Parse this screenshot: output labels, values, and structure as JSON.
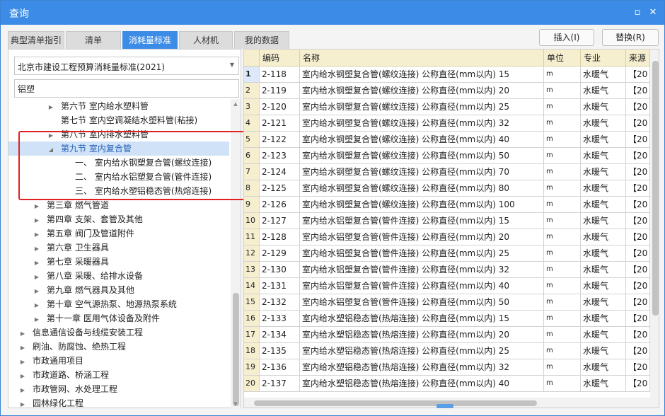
{
  "window": {
    "title": "查询",
    "min": "▫",
    "close": "✕"
  },
  "tabs": [
    {
      "label": "典型清单指引",
      "active": false
    },
    {
      "label": "清单",
      "active": false
    },
    {
      "label": "消耗量标准",
      "active": true
    },
    {
      "label": "人材机",
      "active": false
    },
    {
      "label": "我的数据",
      "active": false
    }
  ],
  "actions": {
    "insert": "插入(I)",
    "replace": "替换(R)"
  },
  "left": {
    "standard": "北京市建设工程预算消耗量标准(2021)",
    "search_value": "铝塑",
    "tree": [
      {
        "label": "第六节 室内给水塑料管",
        "indent": 3,
        "toggle": "▶",
        "selected": false
      },
      {
        "label": "第七节 室内空调凝结水塑料管(粘接)",
        "indent": 3,
        "toggle": "",
        "selected": false
      },
      {
        "label": "第八节 室内排水塑料管",
        "indent": 3,
        "toggle": "▶",
        "selected": false
      },
      {
        "label": "第九节 室内复合管",
        "indent": 3,
        "toggle": "◢",
        "selected": true
      },
      {
        "label": "一、  室内给水钢塑复合管(螺纹连接)",
        "indent": 4,
        "toggle": "",
        "selected": false
      },
      {
        "label": "二、  室内给水铝塑复合管(管件连接)",
        "indent": 4,
        "toggle": "",
        "selected": false
      },
      {
        "label": "三、  室内给水塑铝稳态管(热熔连接)",
        "indent": 4,
        "toggle": "",
        "selected": false
      },
      {
        "label": "第三章 燃气管道",
        "indent": 2,
        "toggle": "▶",
        "selected": false
      },
      {
        "label": "第四章 支架、套管及其他",
        "indent": 2,
        "toggle": "▶",
        "selected": false
      },
      {
        "label": "第五章 阀门及管道附件",
        "indent": 2,
        "toggle": "▶",
        "selected": false
      },
      {
        "label": "第六章 卫生器具",
        "indent": 2,
        "toggle": "▶",
        "selected": false
      },
      {
        "label": "第七章 采暖器具",
        "indent": 2,
        "toggle": "▶",
        "selected": false
      },
      {
        "label": "第八章 采暖、给排水设备",
        "indent": 2,
        "toggle": "▶",
        "selected": false
      },
      {
        "label": "第九章 燃气器具及其他",
        "indent": 2,
        "toggle": "▶",
        "selected": false
      },
      {
        "label": "第十章 空气源热泵、地源热泵系统",
        "indent": 2,
        "toggle": "▶",
        "selected": false
      },
      {
        "label": "第十一章 医用气体设备及附件",
        "indent": 2,
        "toggle": "▶",
        "selected": false
      },
      {
        "label": "信息通信设备与线缆安装工程",
        "indent": 1,
        "toggle": "▶",
        "selected": false
      },
      {
        "label": "刷油、防腐蚀、绝热工程",
        "indent": 1,
        "toggle": "▶",
        "selected": false
      },
      {
        "label": "市政通用项目",
        "indent": 1,
        "toggle": "▶",
        "selected": false
      },
      {
        "label": "市政道路、桥涵工程",
        "indent": 1,
        "toggle": "▶",
        "selected": false
      },
      {
        "label": "市政管网、水处理工程",
        "indent": 1,
        "toggle": "▶",
        "selected": false
      },
      {
        "label": "园林绿化工程",
        "indent": 1,
        "toggle": "▶",
        "selected": false
      }
    ]
  },
  "grid": {
    "columns": [
      "编码",
      "名称",
      "单位",
      "专业",
      "来源"
    ],
    "rows": [
      {
        "no": "1",
        "code": "2-118",
        "name": "室内给水钢塑复合管(螺纹连接) 公称直径(mm以内) 15",
        "unit": "m",
        "major": "水暖气",
        "src": "【20"
      },
      {
        "no": "2",
        "code": "2-119",
        "name": "室内给水钢塑复合管(螺纹连接) 公称直径(mm以内) 20",
        "unit": "m",
        "major": "水暖气",
        "src": "【20"
      },
      {
        "no": "3",
        "code": "2-120",
        "name": "室内给水钢塑复合管(螺纹连接) 公称直径(mm以内) 25",
        "unit": "m",
        "major": "水暖气",
        "src": "【20"
      },
      {
        "no": "4",
        "code": "2-121",
        "name": "室内给水钢塑复合管(螺纹连接) 公称直径(mm以内) 32",
        "unit": "m",
        "major": "水暖气",
        "src": "【20"
      },
      {
        "no": "5",
        "code": "2-122",
        "name": "室内给水钢塑复合管(螺纹连接) 公称直径(mm以内) 40",
        "unit": "m",
        "major": "水暖气",
        "src": "【20"
      },
      {
        "no": "6",
        "code": "2-123",
        "name": "室内给水钢塑复合管(螺纹连接) 公称直径(mm以内) 50",
        "unit": "m",
        "major": "水暖气",
        "src": "【20"
      },
      {
        "no": "7",
        "code": "2-124",
        "name": "室内给水钢塑复合管(螺纹连接) 公称直径(mm以内) 70",
        "unit": "m",
        "major": "水暖气",
        "src": "【20"
      },
      {
        "no": "8",
        "code": "2-125",
        "name": "室内给水钢塑复合管(螺纹连接) 公称直径(mm以内) 80",
        "unit": "m",
        "major": "水暖气",
        "src": "【20"
      },
      {
        "no": "9",
        "code": "2-126",
        "name": "室内给水钢塑复合管(螺纹连接) 公称直径(mm以内) 100",
        "unit": "m",
        "major": "水暖气",
        "src": "【20"
      },
      {
        "no": "10",
        "code": "2-127",
        "name": "室内给水铝塑复合管(管件连接) 公称直径(mm以内) 15",
        "unit": "m",
        "major": "水暖气",
        "src": "【20"
      },
      {
        "no": "11",
        "code": "2-128",
        "name": "室内给水铝塑复合管(管件连接) 公称直径(mm以内) 20",
        "unit": "m",
        "major": "水暖气",
        "src": "【20"
      },
      {
        "no": "12",
        "code": "2-129",
        "name": "室内给水铝塑复合管(管件连接) 公称直径(mm以内) 25",
        "unit": "m",
        "major": "水暖气",
        "src": "【20"
      },
      {
        "no": "13",
        "code": "2-130",
        "name": "室内给水铝塑复合管(管件连接) 公称直径(mm以内) 32",
        "unit": "m",
        "major": "水暖气",
        "src": "【20"
      },
      {
        "no": "14",
        "code": "2-131",
        "name": "室内给水铝塑复合管(管件连接) 公称直径(mm以内) 40",
        "unit": "m",
        "major": "水暖气",
        "src": "【20"
      },
      {
        "no": "15",
        "code": "2-132",
        "name": "室内给水铝塑复合管(管件连接) 公称直径(mm以内) 50",
        "unit": "m",
        "major": "水暖气",
        "src": "【20"
      },
      {
        "no": "16",
        "code": "2-133",
        "name": "室内给水塑铝稳态管(热熔连接) 公称直径(mm以内) 15",
        "unit": "m",
        "major": "水暖气",
        "src": "【20"
      },
      {
        "no": "17",
        "code": "2-134",
        "name": "室内给水塑铝稳态管(热熔连接) 公称直径(mm以内) 20",
        "unit": "m",
        "major": "水暖气",
        "src": "【20"
      },
      {
        "no": "18",
        "code": "2-135",
        "name": "室内给水塑铝稳态管(热熔连接) 公称直径(mm以内) 25",
        "unit": "m",
        "major": "水暖气",
        "src": "【20"
      },
      {
        "no": "19",
        "code": "2-136",
        "name": "室内给水塑铝稳态管(热熔连接) 公称直径(mm以内) 32",
        "unit": "m",
        "major": "水暖气",
        "src": "【20"
      },
      {
        "no": "20",
        "code": "2-137",
        "name": "室内给水塑铝稳态管(热熔连接) 公称直径(mm以内) 40",
        "unit": "m",
        "major": "水暖气",
        "src": "【20"
      }
    ]
  },
  "colors": {
    "accent": "#3c8ce7",
    "header_bg": "#f6efcf",
    "highlight_box": "#e02222"
  }
}
